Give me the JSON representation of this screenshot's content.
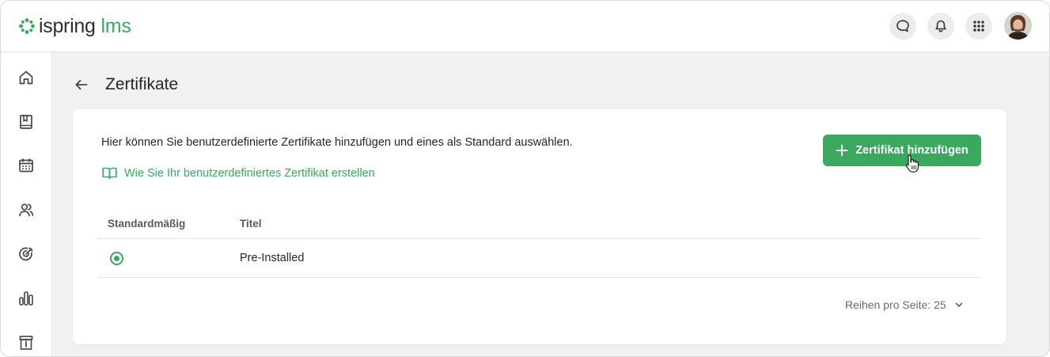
{
  "brand": {
    "name": "ispring",
    "product": "lms",
    "accent": "#3aa85d"
  },
  "header": {
    "icons": [
      "chat-icon",
      "bell-icon",
      "apps-grid-icon"
    ],
    "avatar": "user-avatar"
  },
  "sidebar": {
    "items": [
      {
        "icon": "home-icon"
      },
      {
        "icon": "book-icon"
      },
      {
        "icon": "calendar-icon"
      },
      {
        "icon": "users-icon"
      },
      {
        "icon": "target-icon"
      },
      {
        "icon": "reports-chart-icon"
      },
      {
        "icon": "info-archive-icon"
      }
    ]
  },
  "page": {
    "title": "Zertifikate"
  },
  "card": {
    "description": "Hier können Sie benutzerdefinierte Zertifikate hinzufügen und eines als Standard auswählen.",
    "help_link": "Wie Sie Ihr benutzerdefiniertes Zertifikat erstellen",
    "add_button": "Zertifikat hinzufügen"
  },
  "table": {
    "columns": [
      "Standardmäßig",
      "Titel"
    ],
    "rows": [
      {
        "default": true,
        "title": "Pre-Installed"
      }
    ]
  },
  "pagination": {
    "rows_per_page_label": "Reihen pro Seite: 25"
  }
}
